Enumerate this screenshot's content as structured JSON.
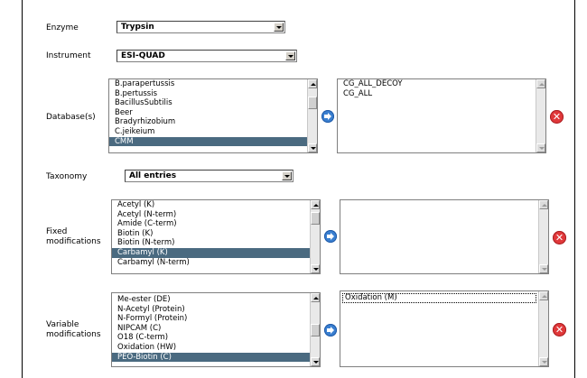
{
  "form": {
    "enzyme": {
      "label": "Enzyme",
      "value": "Trypsin"
    },
    "instrument": {
      "label": "Instrument",
      "value": "ESI-QUAD"
    },
    "databases": {
      "label": "Database(s)",
      "available": [
        "B.parapertussis",
        "B.pertussis",
        "BacillusSubtilis",
        "Beer",
        "Bradyrhizobium",
        "C.jeikeium",
        "CMM"
      ],
      "selected_available": "CMM",
      "chosen": [
        "CG_ALL_DECOY",
        "CG_ALL"
      ]
    },
    "taxonomy": {
      "label": "Taxonomy",
      "value": "All entries"
    },
    "fixed_mods": {
      "label_line1": "Fixed",
      "label_line2": "modifications",
      "available": [
        "Acetyl (K)",
        "Acetyl (N-term)",
        "Amide (C-term)",
        "Biotin (K)",
        "Biotin (N-term)",
        "Carbamyl (K)",
        "Carbamyl (N-term)"
      ],
      "selected_available": "Carbamyl (K)",
      "chosen": []
    },
    "variable_mods": {
      "label_line1": "Variable",
      "label_line2": "modifications",
      "available": [
        "Me-ester (DE)",
        "N-Acetyl (Protein)",
        "N-Formyl (Protein)",
        "NIPCAM (C)",
        "O18 (C-term)",
        "Oxidation (HW)",
        "PEO-Biotin (C)"
      ],
      "selected_available": "PEO-Biotin (C)",
      "chosen": [
        "Oxidation (M)"
      ]
    }
  },
  "colors": {
    "selection": "#4a6a80",
    "add_button": "#3a7fd0",
    "remove_button": "#e0383a"
  },
  "icons": {
    "add": "arrow-right-icon",
    "remove": "close-icon"
  }
}
